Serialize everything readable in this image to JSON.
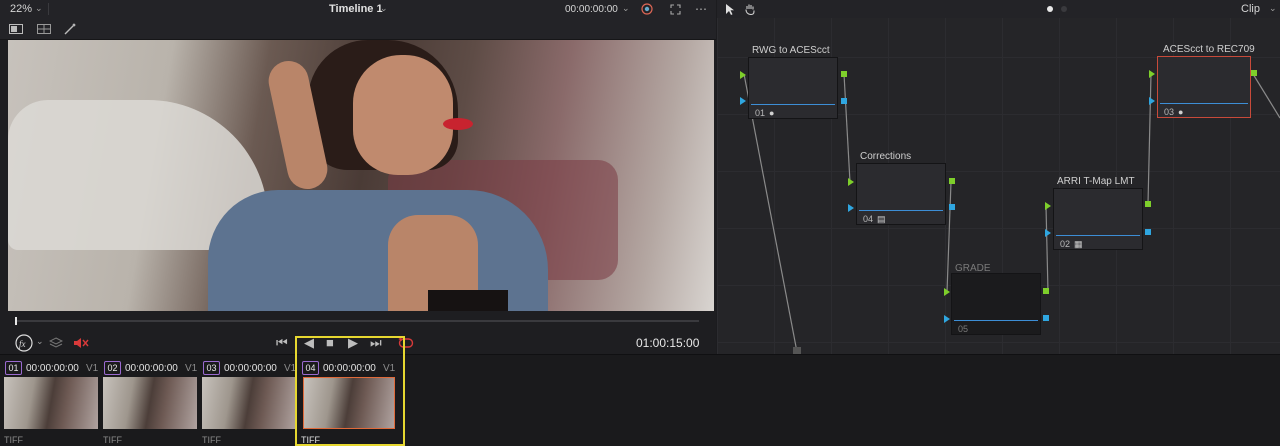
{
  "viewer": {
    "zoom": "22%",
    "timeline_title": "Timeline 1",
    "timecode": "00:00:00:00",
    "current_time": "01:00:15:00",
    "playhead_fraction": 0.0
  },
  "node_panel": {
    "mode_label": "Clip",
    "nodes": [
      {
        "title": "RWG to ACEScct",
        "number": "01",
        "icon": "ace-icon",
        "active": false
      },
      {
        "title": "Corrections",
        "number": "04",
        "icon": "bars-icon",
        "active": false
      },
      {
        "title": "GRADE",
        "number": "05",
        "icon": "",
        "active": false
      },
      {
        "title": "ARRI T-Map LMT",
        "number": "02",
        "icon": "grid-icon",
        "active": false
      },
      {
        "title": "ACEScct to REC709",
        "number": "03",
        "icon": "ace-icon",
        "active": true
      }
    ]
  },
  "clips": [
    {
      "badge": "01",
      "timecode": "00:00:00:00",
      "track": "V1",
      "format": "TIFF",
      "badge_color": "#9a6ad0"
    },
    {
      "badge": "02",
      "timecode": "00:00:00:00",
      "track": "V1",
      "format": "TIFF",
      "badge_color": "#9a6ad0"
    },
    {
      "badge": "03",
      "timecode": "00:00:00:00",
      "track": "V1",
      "format": "TIFF",
      "badge_color": "#9a6ad0"
    },
    {
      "badge": "04",
      "timecode": "00:00:00:00",
      "track": "V1",
      "format": "TIFF",
      "badge_color": "#9a6ad0"
    }
  ],
  "colors": {
    "accent_highlight": "#e6d730",
    "active_node_border": "#c84a3a",
    "port_green": "#7ecf2b",
    "port_blue": "#2fa6e0",
    "loop_red": "#d93a3a"
  }
}
